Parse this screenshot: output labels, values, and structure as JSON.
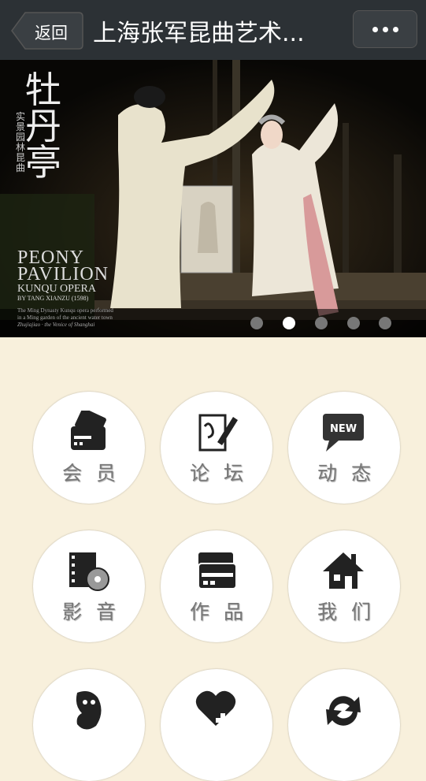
{
  "topbar": {
    "back_label": "返回",
    "title": "上海张军昆曲艺术...",
    "more_icon": "more-dots-icon"
  },
  "banner": {
    "vertical_title": "牡丹亭",
    "vertical_sub": "实景园林昆曲",
    "en_title_1": "PEONY",
    "en_title_2": "PAVILION",
    "en_sub": "KUNQU OPERA",
    "en_by": "BY TANG XIANZU (1598)",
    "caption_1": "The Ming Dynasty Kunqu opera performed",
    "caption_2": "in a Ming garden of the ancient water town",
    "caption_3": "Zhujiajiao · the Venice of Shanghai",
    "slides": 5,
    "active_slide": 2
  },
  "menu": [
    {
      "label": "会员",
      "icon": "member-card-icon"
    },
    {
      "label": "论坛",
      "icon": "forum-pen-icon"
    },
    {
      "label": "动态",
      "icon": "new-bubble-icon"
    },
    {
      "label": "影音",
      "icon": "film-reel-icon"
    },
    {
      "label": "作品",
      "icon": "cards-icon"
    },
    {
      "label": "我们",
      "icon": "home-icon"
    },
    {
      "label": "",
      "icon": "opera-mask-icon"
    },
    {
      "label": "",
      "icon": "heart-plus-icon"
    },
    {
      "label": "",
      "icon": "refresh-arrows-icon"
    }
  ],
  "colors": {
    "topbar": "#2c3135",
    "background": "#f8f0dc",
    "label": "#777777"
  }
}
